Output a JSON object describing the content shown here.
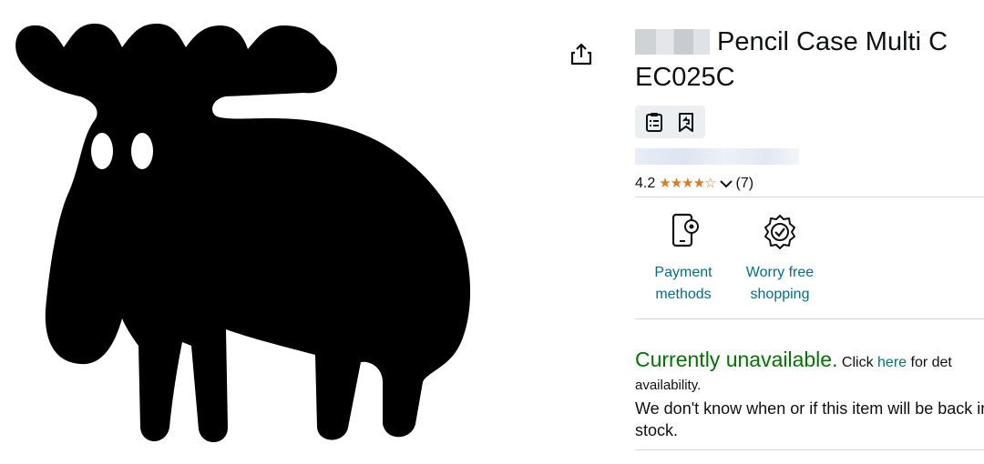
{
  "product": {
    "title_line1": "Pencil Case Multi C",
    "title_line2": "EC025C",
    "rating_value": "4.2",
    "stars_display": "★★★★☆",
    "rating_count": "(7)"
  },
  "icons": {
    "share": "share-icon",
    "clipboard": "clipboard-list-icon",
    "bookmark": "bookmark-return-icon",
    "chevron": "chevron-down-icon",
    "payment": "phone-payment-icon",
    "guarantee": "badge-check-icon"
  },
  "features": [
    {
      "line1": "Payment",
      "line2": "methods"
    },
    {
      "line1": "Worry free",
      "line2": "shopping"
    }
  ],
  "availability": {
    "status": "Currently unavailable.",
    "click_text": "Click",
    "here_link": "here",
    "for_text": "for det",
    "availability_word": "availability.",
    "message": "We don't know when or if this item will be back in stock."
  },
  "colors": {
    "unavailable_green": "#007600",
    "link_teal": "#007185",
    "star_orange": "#de7921",
    "text_dark": "#0f1111"
  }
}
